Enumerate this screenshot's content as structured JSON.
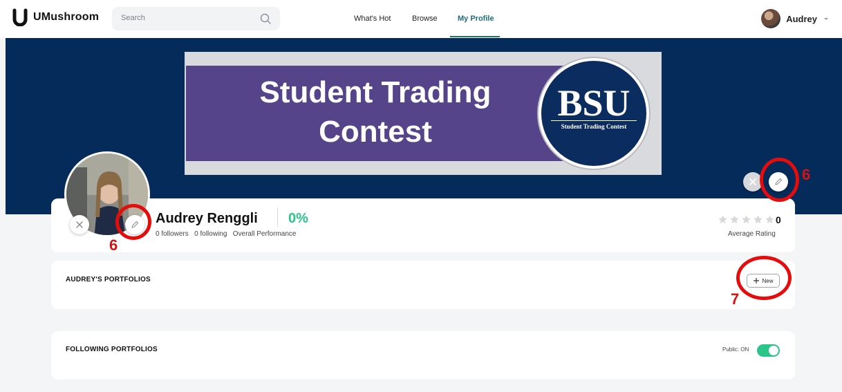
{
  "app": {
    "name": "UMushroom"
  },
  "search": {
    "placeholder": "Search",
    "icon": "search-icon"
  },
  "nav": {
    "items": [
      "What's Hot",
      "Browse",
      "My Profile"
    ],
    "active": "My Profile"
  },
  "user": {
    "name": "Audrey"
  },
  "banner": {
    "title_line1": "Student Trading",
    "title_line2": "Contest",
    "badge_big": "BSU",
    "badge_small": "Student Trading Contest"
  },
  "profile": {
    "name": "Audrey Renggli",
    "performance": "0%",
    "followers": "0 followers",
    "following": "0 following",
    "performance_label": "Overall Performance",
    "rating_count": "0",
    "rating_label": "Average Rating",
    "rating_stars_filled": 0,
    "rating_stars_total": 5
  },
  "sections": {
    "portfolios_title": "AUDREY'S PORTFOLIOS",
    "new_button": "New",
    "following_title": "FOLLOWING PORTFOLIOS",
    "public_label": "Public: ON",
    "public_on": true
  },
  "annotations": {
    "edit_banner": "6",
    "edit_avatar": "6",
    "new_portfolio": "7"
  },
  "colors": {
    "banner_bg": "#052b5a",
    "accent_green": "#2bc58a",
    "nav_active": "#1f6e78",
    "annotation_red": "#e50c0c"
  }
}
